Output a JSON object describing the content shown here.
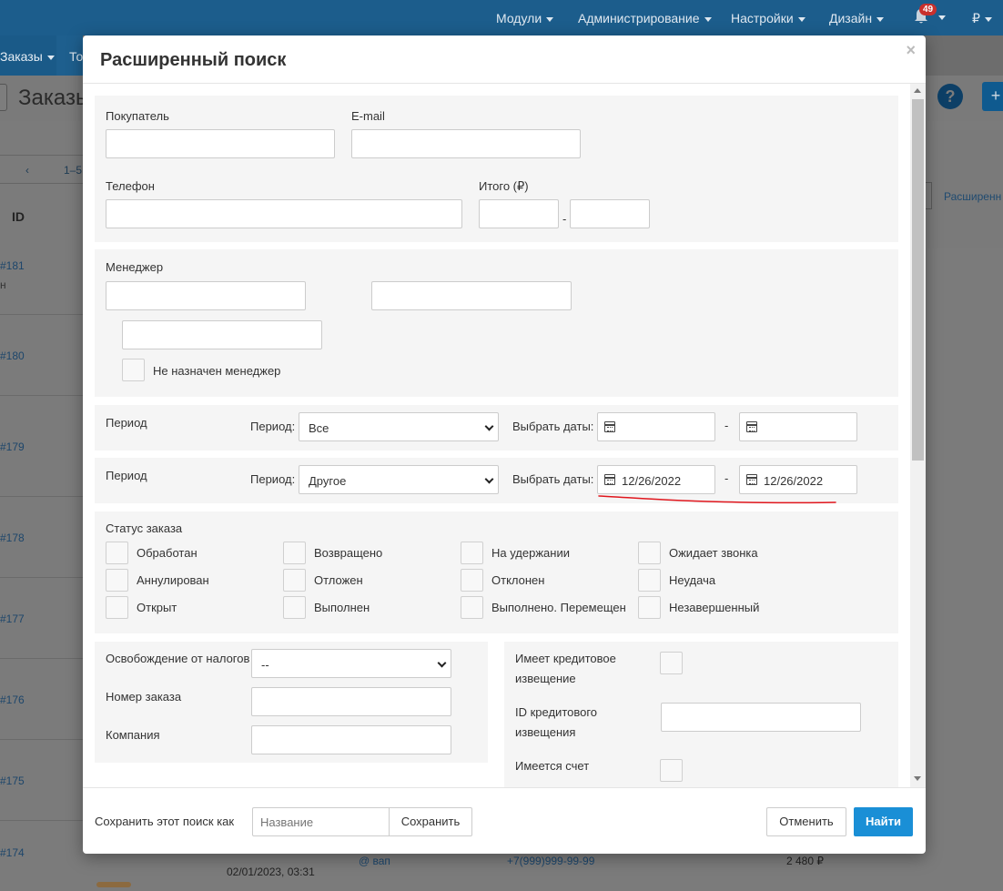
{
  "background": {
    "nav": [
      "Модули",
      "Администрирование",
      "Настройки",
      "Дизайн"
    ],
    "currency": "₽",
    "notif_count": "49",
    "tab_orders": "Заказы",
    "tab_other": "То",
    "page_title": "Заказы",
    "pager_prev": "‹",
    "pager_range": "1–5",
    "id_header": "ID",
    "orders": [
      "#181",
      "#180",
      "#179",
      "#178",
      "#177",
      "#176",
      "#175",
      "#174"
    ],
    "order_sub": "н",
    "help": "?",
    "plus": "+",
    "advanced_link": "Расширенн",
    "row_date1": "02/01/2023, 03:31",
    "row_date2": "02/01/2023, 03:31",
    "row_mail": "@ вап",
    "row_phone": "+7(999)999-99-99",
    "row_sum": "2 480 ₽"
  },
  "modal": {
    "title": "Расширенный поиск",
    "close": "×",
    "buyer_label": "Покупатель",
    "email_label": "E-mail",
    "phone_label": "Телефон",
    "total_label": "Итого (₽)",
    "range_dash": "-",
    "manager_label": "Менеджер",
    "no_manager_label": "Не назначен менеджер",
    "period1": {
      "label": "Период",
      "select_label": "Период:",
      "select_value": "Все",
      "dates_label": "Выбрать даты:",
      "date_from": "",
      "date_to": ""
    },
    "period2": {
      "label": "Период",
      "select_label": "Период:",
      "select_value": "Другое",
      "dates_label": "Выбрать даты:",
      "date_from": "12/26/2022",
      "date_to": "12/26/2022"
    },
    "status_label": "Статус заказа",
    "statuses": [
      "Обработан",
      "Возвращено",
      "На удержании",
      "Ожидает звонка",
      "Аннулирован",
      "Отложен",
      "Отклонен",
      "Неудача",
      "Открыт",
      "Выполнен",
      "Выполнено. Перемещен",
      "Незавершенный"
    ],
    "tax_label": "Освобождение от налогов",
    "tax_value": "--",
    "order_num_label": "Номер заказа",
    "company_label": "Компания",
    "credit_note_label_1": "Имеет кредитовое",
    "credit_note_label_2": "извещение",
    "credit_id_label_1": "ID кредитового",
    "credit_id_label_2": "извещения",
    "has_invoice_label": "Имеется счет",
    "save_as_label": "Сохранить этот поиск как",
    "name_placeholder": "Название",
    "save_button": "Сохранить",
    "cancel_button": "Отменить",
    "find_button": "Найти",
    "annotation_color": "#e0161d"
  }
}
